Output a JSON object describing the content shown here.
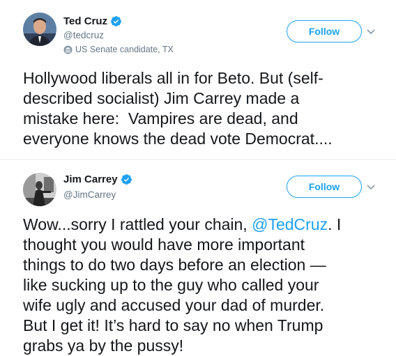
{
  "tweets": [
    {
      "display_name": "Ted Cruz",
      "handle": "@tedcruz",
      "account_label": "US Senate candidate, TX",
      "follow_label": "Follow",
      "text": "Hollywood liberals all in for Beto. But (self-\ndescribed socialist) Jim Carrey made a\nmistake here:  Vampires are dead, and\neveryone knows the dead vote Democrat...."
    },
    {
      "display_name": "Jim Carrey",
      "handle": "@JimCarrey",
      "follow_label": "Follow",
      "text_before": "Wow...sorry I rattled your chain, ",
      "mention": "@TedCruz",
      "text_after": ". I\nthought you would have more important\nthings to do two days before an election —\nlike sucking up to the guy who called your\nwife ugly and accused your dad of murder.\nBut I get it! It’s hard to say no when Trump\ngrabs ya by the pussy!"
    }
  ],
  "icons": {
    "verified": "verified-badge-icon",
    "government": "government-building-icon",
    "chevron": "chevron-down-icon"
  },
  "colors": {
    "accent": "#1da1f2",
    "secondary_text": "#657786",
    "primary_text": "#14171a",
    "divider": "#e6ecf0"
  }
}
